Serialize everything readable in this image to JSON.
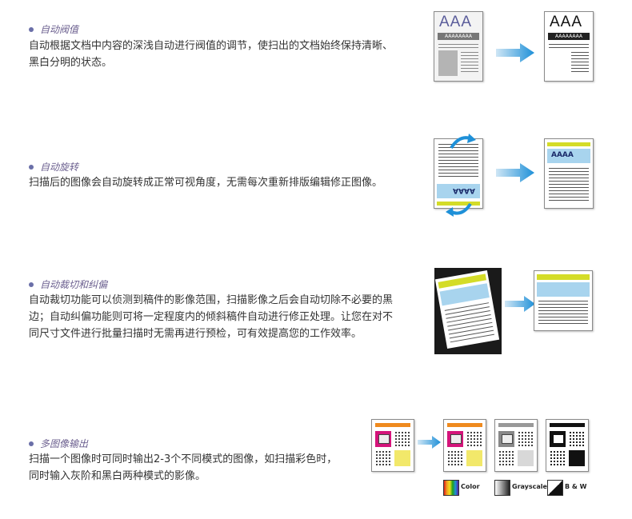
{
  "colors": {
    "accent_blue": "#1e90d8",
    "yellow": "#d4dc28",
    "light_blue": "#a8d4ee",
    "orange": "#ef8a1e",
    "magenta": "#d4147a"
  },
  "sections": [
    {
      "title": "自动阀值",
      "lines": [
        "自动根据文档中内容的深浅自动进行阀值的调节，使扫出的文档始终保持清晰、",
        "黑白分明的状态。"
      ]
    },
    {
      "title": "自动旋转",
      "lines": [
        "扫描后的图像会自动旋转成正常可视角度，无需每次重新排版编辑修正图像。"
      ]
    },
    {
      "title": "自动裁切和纠偏",
      "lines": [
        "自动裁切功能可以侦测到稿件的影像范围，扫描影像之后会自动切除不必要的黑",
        "边；自动纠偏功能则可将一定程度内的倾斜稿件自动进行修正处理。让您在对不",
        "同尺寸文件进行批量扫描时无需再进行预检，可有效提高您的工作效率。"
      ]
    },
    {
      "title": "多图像输出",
      "lines": [
        "扫描一个图像时可同时输出2-3个不同模式的图像，如扫描彩色时，",
        "同时输入灰阶和黑白两种模式的影像。"
      ]
    }
  ],
  "figures": {
    "threshold": {
      "big_text": "AAA",
      "small_text": "AAAAAAAA"
    },
    "rotate": {
      "label": "AAAA"
    },
    "multi": {
      "legend": [
        "Color",
        "Grayscale",
        "B & W"
      ]
    }
  }
}
